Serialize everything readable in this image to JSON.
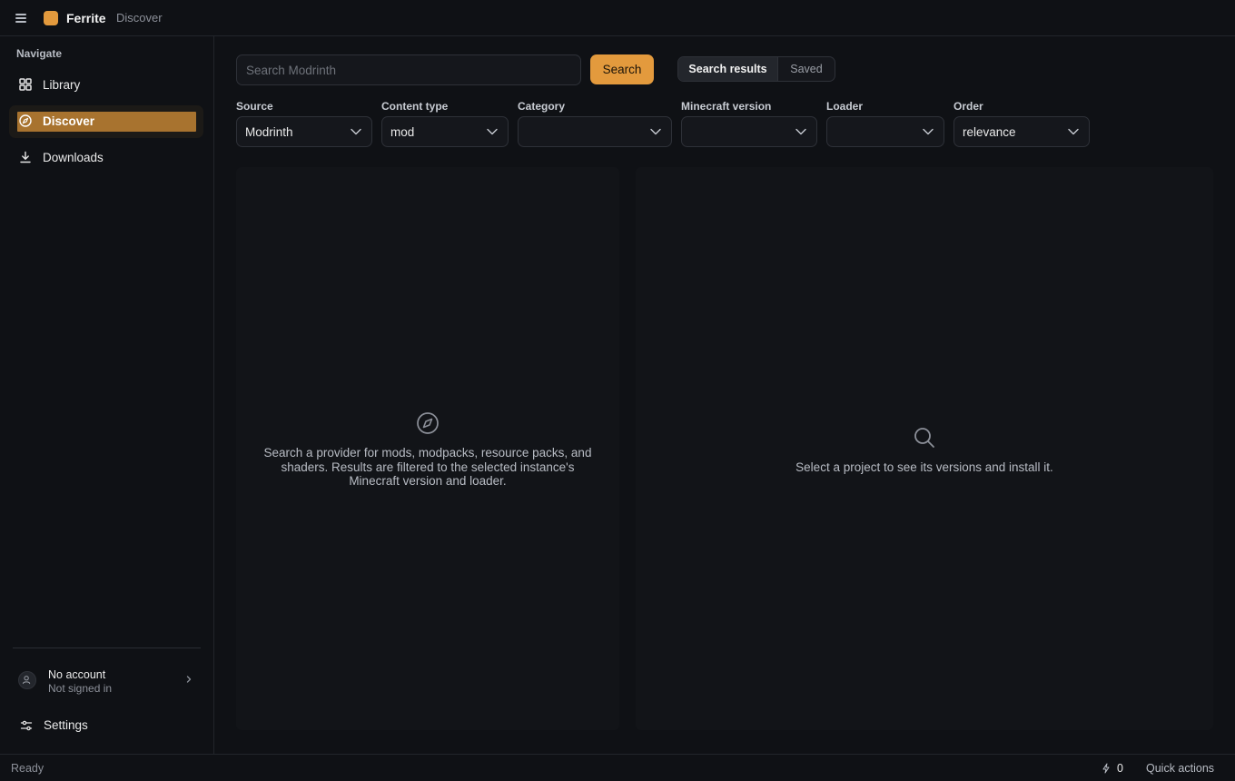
{
  "app": {
    "name": "Ferrite",
    "breadcrumb": "Discover",
    "brand_color": "#e39a3d"
  },
  "sidebar": {
    "heading": "Navigate",
    "items": [
      {
        "label": "Library",
        "icon": "grid-icon"
      },
      {
        "label": "Discover",
        "icon": "compass-icon",
        "active": true
      },
      {
        "label": "Downloads",
        "icon": "download-icon"
      }
    ],
    "account": {
      "name": "No account",
      "status": "Not signed in"
    },
    "settings_label": "Settings"
  },
  "search": {
    "placeholder": "Search Modrinth",
    "value": "",
    "button_label": "Search",
    "tabs": [
      {
        "label": "Search results",
        "active": true
      },
      {
        "label": "Saved",
        "active": false
      }
    ]
  },
  "filters": [
    {
      "label": "Source",
      "value": "Modrinth"
    },
    {
      "label": "Content type",
      "value": "mod"
    },
    {
      "label": "Category",
      "value": ""
    },
    {
      "label": "Minecraft version",
      "value": ""
    },
    {
      "label": "Loader",
      "value": ""
    },
    {
      "label": "Order",
      "value": "relevance"
    }
  ],
  "results_empty": "Search a provider for mods, modpacks, resource packs, and shaders. Results are filtered to the selected instance's Minecraft version and loader.",
  "details_empty": "Select a project to see its versions and install it.",
  "statusbar": {
    "status": "Ready",
    "count": "0",
    "quick_actions": "Quick actions"
  }
}
